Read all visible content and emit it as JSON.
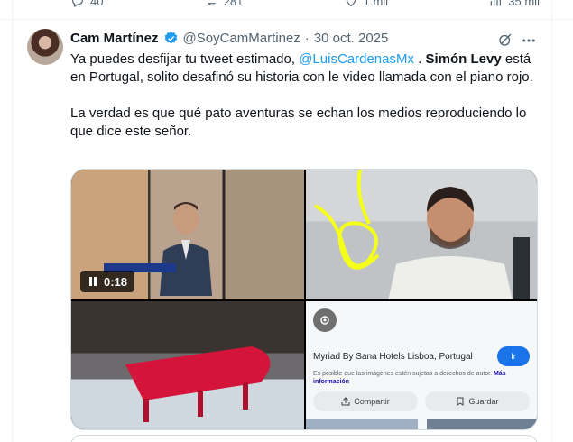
{
  "top_actions": {
    "replies": "40",
    "reposts": "281",
    "likes": "1 mil",
    "views": "35 mil"
  },
  "tweet": {
    "author_name": "Cam Martínez",
    "handle": "@SoyCamMartinez",
    "separator": "·",
    "date": "30 oct. 2025",
    "text_1a": "Ya puedes desfijar tu tweet estimado, ",
    "mention": "@LuisCardenasMx",
    "text_1b": " . ",
    "bold_name": "Simón Levy",
    "text_1c": " está en Portugal, solito desafinó su historia con le video llamada con el piano rojo.",
    "text_2": "La verdad es que qué pato aventuras se echan los medios reproduciendo lo que dice este señor."
  },
  "media": {
    "video_time": "0:18",
    "lens_card": {
      "title": "Myriad By Sana Hotels Lisboa, Portugal",
      "go_button": "Ir",
      "note": "Es posible que las imágenes estén sujetas a derechos de autor.",
      "note_link": "Más información",
      "share": "Compartir",
      "save": "Guardar"
    }
  },
  "colors": {
    "link": "#1d9bf0",
    "secondary_text": "#536471",
    "border": "#cfd9de"
  }
}
